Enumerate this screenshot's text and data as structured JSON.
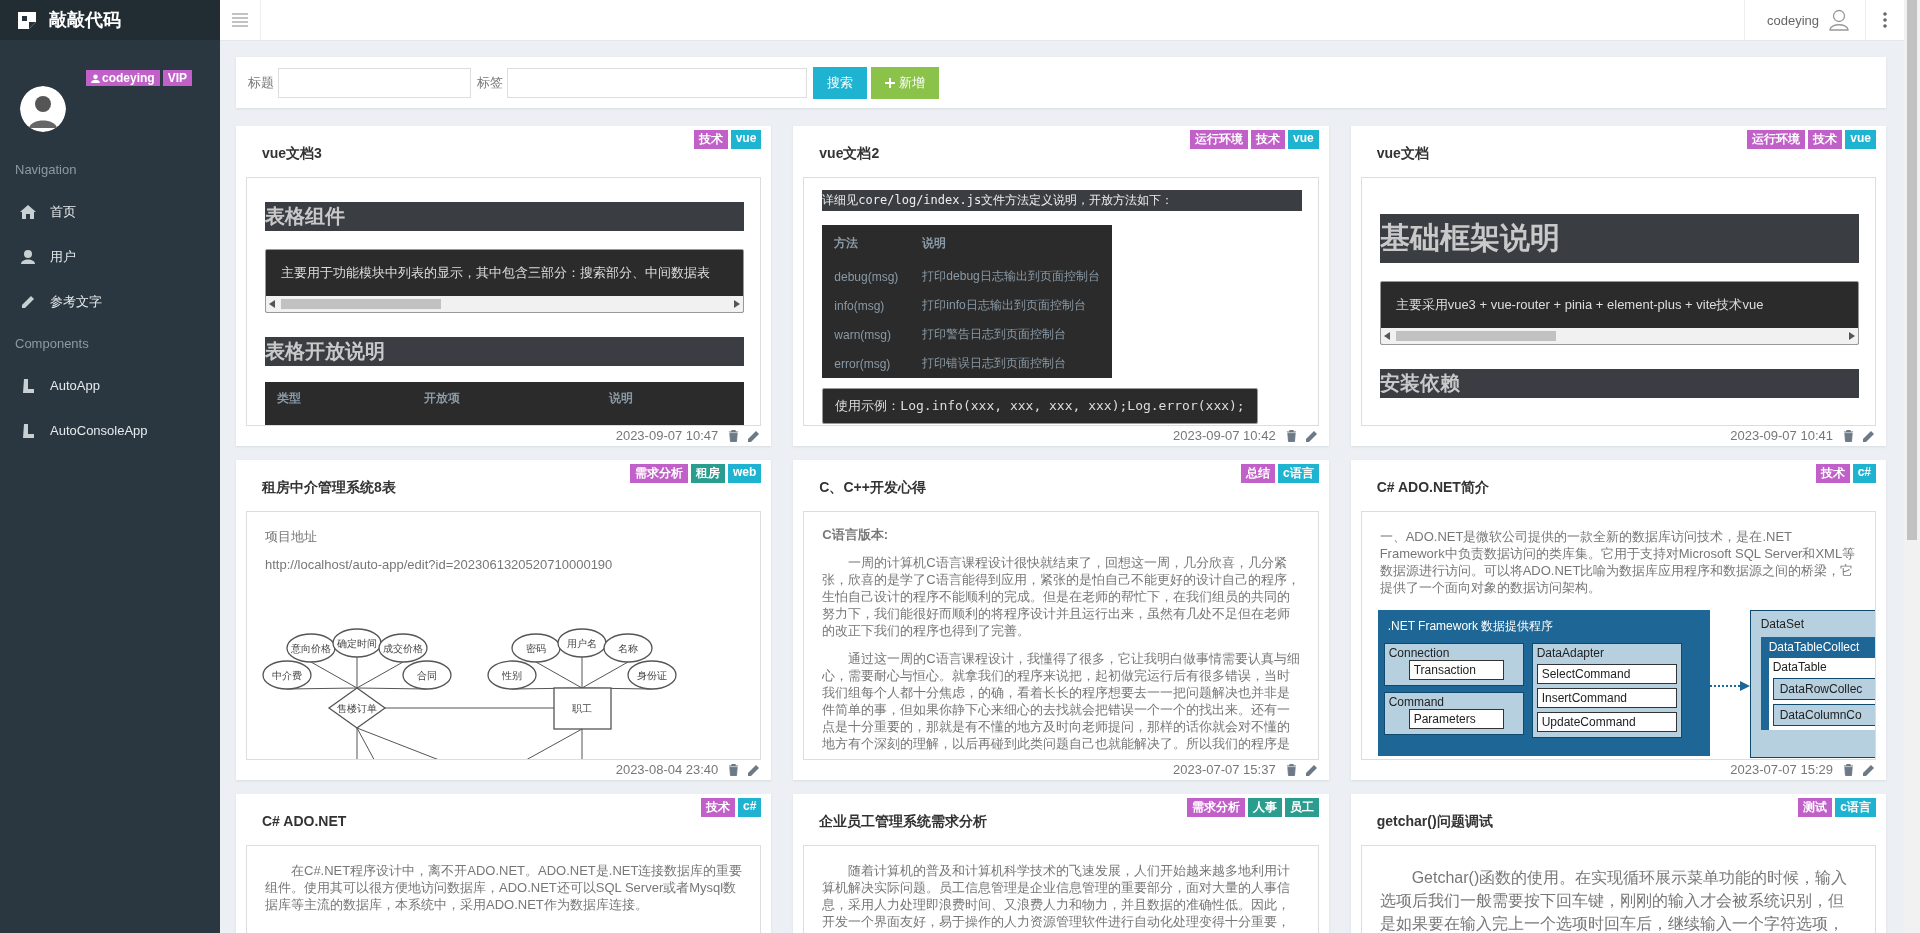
{
  "brand": {
    "name": "敲敲代码"
  },
  "user": {
    "name": "codeying",
    "badge": "VIP"
  },
  "sidebar": {
    "sections": [
      {
        "title": "Navigation",
        "items": [
          {
            "label": "首页",
            "selected": false
          },
          {
            "label": "用户",
            "selected": false
          },
          {
            "label": "参考文字",
            "selected": false
          }
        ]
      },
      {
        "title": "Components",
        "items": [
          {
            "label": "AutoApp",
            "selected": false
          },
          {
            "label": "AutoConsoleApp",
            "selected": false
          }
        ]
      }
    ]
  },
  "header": {
    "user": "codeying"
  },
  "search": {
    "title_label": "标题",
    "tag_label": "标签",
    "search_button": "搜索",
    "add_button": "新增"
  },
  "cards": [
    {
      "title": "vue文档3",
      "tags": [
        {
          "label": "技术",
          "color": "#c060c8"
        },
        {
          "label": "vue",
          "color": "#1fb3d2"
        }
      ],
      "date": "2023-09-07 10:47",
      "blocks": [
        {
          "kind": "heading",
          "text": "表格组件"
        },
        {
          "kind": "code",
          "text": "主要用于功能模块中列表的显示，其中包含三部分：搜索部分、中间数据表",
          "scrollbar": true
        },
        {
          "kind": "heading",
          "text": "表格开放说明"
        },
        {
          "kind": "table",
          "columns": [
            "类型",
            "开放项",
            "说明"
          ]
        }
      ]
    },
    {
      "title": "vue文档2",
      "tags": [
        {
          "label": "运行环境",
          "color": "#c060c8"
        },
        {
          "label": "技术",
          "color": "#c060c8"
        },
        {
          "label": "vue",
          "color": "#1fb3d2"
        }
      ],
      "date": "2023-09-07 10:42",
      "blocks": [
        {
          "kind": "highlight",
          "text": "详细见core/log/index.js文件方法定义说明，开放方法如下："
        },
        {
          "kind": "table",
          "columns": [
            "方法",
            "说明"
          ],
          "rows": [
            [
              "debug(msg)",
              "打印debug日志输出到页面控制台"
            ],
            [
              "info(msg)",
              "打印info日志输出到页面控制台"
            ],
            [
              "warn(msg)",
              "打印警告日志到页面控制台"
            ],
            [
              "error(msg)",
              "打印错误日志到页面控制台"
            ]
          ]
        },
        {
          "kind": "code",
          "text": "使用示例：Log.info(xxx, xxx, xxx, xxx);Log.error(xxx);",
          "scrollbar": false
        }
      ]
    },
    {
      "title": "vue文档",
      "tags": [
        {
          "label": "运行环境",
          "color": "#c060c8"
        },
        {
          "label": "技术",
          "color": "#c060c8"
        },
        {
          "label": "vue",
          "color": "#1fb3d2"
        }
      ],
      "date": "2023-09-07 10:41",
      "blocks": [
        {
          "kind": "title",
          "text": "基础框架说明"
        },
        {
          "kind": "code",
          "text": "主要采用vue3 + vue-router + pinia + element-plus + vite技术vue",
          "scrollbar": true
        },
        {
          "kind": "heading",
          "text": "安装依赖"
        }
      ]
    },
    {
      "title": "租房中介管理系统8表",
      "tags": [
        {
          "label": "需求分析",
          "color": "#c060c8"
        },
        {
          "label": "租房",
          "color": "#2a9d8f"
        },
        {
          "label": "web",
          "color": "#1fb3d2"
        }
      ],
      "date": "2023-08-04 23:40",
      "blocks": [
        {
          "kind": "paragraph",
          "text": "项目地址",
          "indent": false
        },
        {
          "kind": "paragraph",
          "text": "http://localhost/auto-app/edit?id=2023061320520710000190",
          "indent": false
        },
        {
          "kind": "er_diagram",
          "left": {
            "entity": "售楼订单",
            "attributes": [
              "意向价格",
              "确定时间",
              "成交价格",
              "中介费",
              "合同"
            ]
          },
          "right": {
            "entity": "职工",
            "attributes": [
              "密码",
              "用户名",
              "名称",
              "性别",
              "身份证"
            ]
          }
        }
      ]
    },
    {
      "title": "C、C++开发心得",
      "tags": [
        {
          "label": "总结",
          "color": "#c060c8"
        },
        {
          "label": "c语言",
          "color": "#1fb3d2"
        }
      ],
      "date": "2023-07-07 15:37",
      "blocks": [
        {
          "kind": "label",
          "text": "C语言版本:"
        },
        {
          "kind": "paragraph",
          "text": "一周的计算机C语言课程设计很快就结束了，回想这一周，几分欣喜，几分紧张，欣喜的是学了C语言能得到应用，紧张的是怕自己不能更好的设计自己的程序，生怕自己设计的程序不能顺利的完成。但是在老师的帮忙下，在我们组员的共同的努力下，我们能很好而顺利的将程序设计并且运行出来，虽然有几处不足但在老师的改正下我们的程序也得到了完善。",
          "indent": true
        },
        {
          "kind": "paragraph",
          "text": "通过这一周的C语言课程设计，我懂得了很多，它让我明白做事情需要认真与细心，需要耐心与恒心。就拿我们的程序来说把，起初做完运行后有很多错误，当时我们组每个人都十分焦虑，的确，看着长长的程序想要去一一把问题解决也并非是件简单的事，但如果你静下心来细心的去找就会把错误一个一个的找出来。还有一点是十分重要的，那就是有不懂的地方及时向老师提问，那样的话你就会对不懂的地方有个深刻的理解，以后再碰到此类问题自己也就能解决了。所以我们的程序是",
          "indent": true
        }
      ]
    },
    {
      "title": "C# ADO.NET简介",
      "tags": [
        {
          "label": "技术",
          "color": "#c060c8"
        },
        {
          "label": "c#",
          "color": "#1fb3d2"
        }
      ],
      "date": "2023-07-07 15:29",
      "blocks": [
        {
          "kind": "paragraph",
          "text": "一、ADO.NET是微软公司提供的一款全新的数据库访问技术，是在.NET Framework中负责数据访问的类库集。它用于支持对Microsoft SQL Server和XML等数据源进行访问。可以将ADO.NET比喻为数据库应用程序和数据源之间的桥梁，它提供了一个面向对象的数据访问架构。",
          "indent": false
        },
        {
          "kind": "ado_diagram",
          "provider": ".NET Framework 数据提供程序",
          "groups": [
            {
              "name": "Connection",
              "items": [
                "Transaction"
              ]
            },
            {
              "name": "Command",
              "items": [
                "Parameters"
              ]
            }
          ],
          "adapter": {
            "name": "DataAdapter",
            "items": [
              "SelectCommand",
              "InsertCommand",
              "UpdateCommand"
            ]
          },
          "dataset": {
            "name": "DataSet",
            "collection": "DataTableCollect",
            "table": "DataTable",
            "items": [
              "DataRowCollec",
              "DataColumnCo"
            ]
          }
        }
      ]
    },
    {
      "title": "C# ADO.NET",
      "tags": [
        {
          "label": "技术",
          "color": "#c060c8"
        },
        {
          "label": "c#",
          "color": "#1fb3d2"
        }
      ],
      "blocks": [
        {
          "kind": "paragraph",
          "text": "在C#.NET程序设计中，离不开ADO.NET。ADO.NET是.NET连接数据库的重要组件。使用其可以很方便地访问数据库，ADO.NET还可以SQL Server或者Mysql数据库等主流的数据库，本系统中，采用ADO.NET作为数据库连接。",
          "indent": true
        }
      ]
    },
    {
      "title": "企业员工管理系统需求分析",
      "tags": [
        {
          "label": "需求分析",
          "color": "#c060c8"
        },
        {
          "label": "人事",
          "color": "#2a9d8f"
        },
        {
          "label": "员工",
          "color": "#2a9d8f"
        }
      ],
      "blocks": [
        {
          "kind": "paragraph",
          "text": "随着计算机的普及和计算机科学技术的飞速发展，人们开始越来越多地利用计算机解决实际问题。员工信息管理是企业信息管理的重要部分，面对大量的人事信息，采用人力处理即浪费时间、又浪费人力和物力，并且数据的准确性低。因此，开发一个界面友好，易于操作的人力资源管理软件进行自动化处理变得十分重要，",
          "indent": true
        }
      ]
    },
    {
      "title": "getchar()问题调试",
      "tags": [
        {
          "label": "测试",
          "color": "#c060c8"
        },
        {
          "label": "c语言",
          "color": "#1fb3d2"
        }
      ],
      "blocks": [
        {
          "kind": "lead",
          "text": "Getchar()函数的使用。在实现循环展示菜单功能的时候，输入选项后我们一般需要按下回车键，刚刚的输入才会被系统识别，但是如果要在输入完上一个选项时回车后，继续输入一个字符选项，"
        }
      ]
    }
  ]
}
